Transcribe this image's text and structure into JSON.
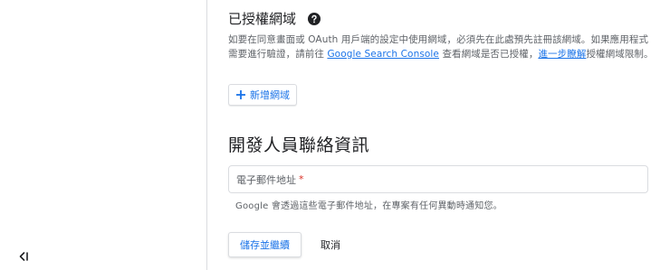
{
  "authorized_domains": {
    "title": "已授權網域",
    "help_icon": "help-circle-icon",
    "description_part1": "如要在同意畫面或 OAuth 用戶端的設定中使用網域，必須先在此處預先註冊該網域。如果應用程式需要進行驗證，請前往 ",
    "search_console_link": "Google Search Console",
    "description_part2": " 查看網域是否已授權，",
    "learn_more_link": "進一步瞭解",
    "description_part3": "授權網域限制。",
    "add_button_icon": "plus-icon",
    "add_button_label": "新增網域"
  },
  "developer_contact": {
    "title": "開發人員聯絡資訊",
    "email_placeholder": "電子郵件地址",
    "required_marker": "*",
    "hint": "Google 會透過這些電子郵件地址，在專案有任何異動時通知您。"
  },
  "actions": {
    "save_label": "儲存並繼續",
    "cancel_label": "取消"
  },
  "nav": {
    "collapse_icon": "collapse-left-icon"
  },
  "colors": {
    "accent": "#1a73e8",
    "required": "#d93025",
    "border": "#dadce0",
    "secondary_text": "#5f6368"
  }
}
